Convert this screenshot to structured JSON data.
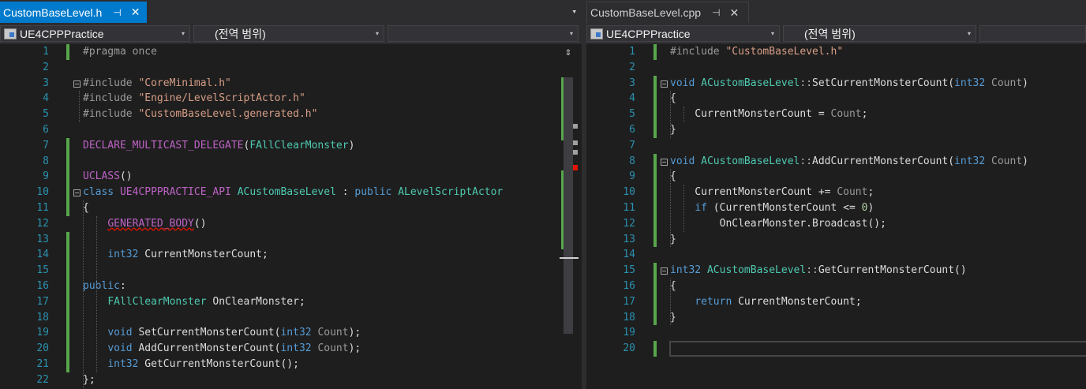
{
  "left_pane": {
    "tab": {
      "title": "CustomBaseLevel.h",
      "pin": "⊣",
      "close": "✕"
    },
    "nav": {
      "project": "UE4CPPPractice",
      "scope": "(전역 범위)",
      "member": ""
    }
  },
  "right_pane": {
    "tab": {
      "title": "CustomBaseLevel.cpp",
      "pin": "⊣",
      "close": "✕"
    },
    "nav": {
      "project": "UE4CPPPractice",
      "scope": "(전역 범위)",
      "member": ""
    }
  },
  "icons": {
    "dropdown": "▾",
    "split": "⇕"
  },
  "colors": {
    "accent": "#007acc",
    "background": "#1e1e1e",
    "line_numbers": "#2b91af",
    "change_bar": "#57a64a",
    "error_mark": "#e51400"
  },
  "header_code": [
    "1",
    "2",
    "3",
    "4",
    "5",
    "6",
    "7",
    "8",
    "9",
    "10",
    "11",
    "12",
    "13",
    "14",
    "15",
    "16",
    "17",
    "18",
    "19",
    "20",
    "21",
    "22"
  ],
  "cpp_code": [
    "1",
    "2",
    "3",
    "4",
    "5",
    "6",
    "7",
    "8",
    "9",
    "10",
    "11",
    "12",
    "13",
    "14",
    "15",
    "16",
    "17",
    "18",
    "19",
    "20"
  ],
  "header_lines": [
    [
      [
        "pp",
        "#pragma once"
      ]
    ],
    [],
    [
      [
        "pp",
        "#include "
      ],
      [
        "str",
        "\"CoreMinimal.h\""
      ]
    ],
    [
      [
        "pp",
        "#include "
      ],
      [
        "str",
        "\"Engine/LevelScriptActor.h\""
      ]
    ],
    [
      [
        "pp",
        "#include "
      ],
      [
        "str",
        "\"CustomBaseLevel.generated.h\""
      ]
    ],
    [],
    [
      [
        "mac",
        "DECLARE_MULTICAST_DELEGATE"
      ],
      [
        "txt",
        "("
      ],
      [
        "typ",
        "FAllClearMonster"
      ],
      [
        "txt",
        ")"
      ]
    ],
    [],
    [
      [
        "mac",
        "UCLASS"
      ],
      [
        "txt",
        "()"
      ]
    ],
    [
      [
        "kw",
        "class "
      ],
      [
        "mac",
        "UE4CPPPRACTICE_API"
      ],
      [
        "txt",
        " "
      ],
      [
        "typ",
        "ACustomBaseLevel"
      ],
      [
        "txt",
        " : "
      ],
      [
        "kw",
        "public "
      ],
      [
        "typ",
        "ALevelScriptActor"
      ]
    ],
    [
      [
        "txt",
        "{"
      ]
    ],
    [
      [
        "txt",
        "    "
      ],
      [
        "mac squig",
        "GENERATED_BODY"
      ],
      [
        "txt",
        "()"
      ]
    ],
    [],
    [
      [
        "txt",
        "    "
      ],
      [
        "kw",
        "int32"
      ],
      [
        "txt",
        " CurrentMonsterCount;"
      ]
    ],
    [],
    [
      [
        "kw",
        "public"
      ],
      [
        "txt",
        ":"
      ]
    ],
    [
      [
        "txt",
        "    "
      ],
      [
        "typ",
        "FAllClearMonster"
      ],
      [
        "txt",
        " OnClearMonster;"
      ]
    ],
    [],
    [
      [
        "txt",
        "    "
      ],
      [
        "kw",
        "void"
      ],
      [
        "txt",
        " SetCurrentMonsterCount("
      ],
      [
        "kw",
        "int32"
      ],
      [
        "txt",
        " "
      ],
      [
        "param",
        "Count"
      ],
      [
        "txt",
        ");"
      ]
    ],
    [
      [
        "txt",
        "    "
      ],
      [
        "kw",
        "void"
      ],
      [
        "txt",
        " AddCurrentMonsterCount("
      ],
      [
        "kw",
        "int32"
      ],
      [
        "txt",
        " "
      ],
      [
        "param",
        "Count"
      ],
      [
        "txt",
        ");"
      ]
    ],
    [
      [
        "txt",
        "    "
      ],
      [
        "kw",
        "int32"
      ],
      [
        "txt",
        " GetCurrentMonsterCount();"
      ]
    ],
    [
      [
        "txt",
        "};"
      ]
    ]
  ],
  "cpp_lines": [
    [
      [
        "pp",
        "#include "
      ],
      [
        "str",
        "\"CustomBaseLevel.h\""
      ]
    ],
    [],
    [
      [
        "kw",
        "void "
      ],
      [
        "typ",
        "ACustomBaseLevel"
      ],
      [
        "op",
        "::"
      ],
      [
        "txt",
        "SetCurrentMonsterCount("
      ],
      [
        "kw",
        "int32"
      ],
      [
        "txt",
        " "
      ],
      [
        "param",
        "Count"
      ],
      [
        "txt",
        ")"
      ]
    ],
    [
      [
        "txt",
        "{"
      ]
    ],
    [
      [
        "txt",
        "    CurrentMonsterCount = "
      ],
      [
        "param",
        "Count"
      ],
      [
        "txt",
        ";"
      ]
    ],
    [
      [
        "txt",
        "}"
      ]
    ],
    [],
    [
      [
        "kw",
        "void "
      ],
      [
        "typ",
        "ACustomBaseLevel"
      ],
      [
        "op",
        "::"
      ],
      [
        "txt",
        "AddCurrentMonsterCount("
      ],
      [
        "kw",
        "int32"
      ],
      [
        "txt",
        " "
      ],
      [
        "param",
        "Count"
      ],
      [
        "txt",
        ")"
      ]
    ],
    [
      [
        "txt",
        "{"
      ]
    ],
    [
      [
        "txt",
        "    CurrentMonsterCount += "
      ],
      [
        "param",
        "Count"
      ],
      [
        "txt",
        ";"
      ]
    ],
    [
      [
        "txt",
        "    "
      ],
      [
        "kw",
        "if"
      ],
      [
        "txt",
        " (CurrentMonsterCount <= "
      ],
      [
        "num",
        "0"
      ],
      [
        "txt",
        ")"
      ]
    ],
    [
      [
        "txt",
        "        OnClearMonster.Broadcast();"
      ]
    ],
    [
      [
        "txt",
        "}"
      ]
    ],
    [],
    [
      [
        "kw",
        "int32 "
      ],
      [
        "typ",
        "ACustomBaseLevel"
      ],
      [
        "op",
        "::"
      ],
      [
        "txt",
        "GetCurrentMonsterCount()"
      ]
    ],
    [
      [
        "txt",
        "{"
      ]
    ],
    [
      [
        "txt",
        "    "
      ],
      [
        "kw",
        "return"
      ],
      [
        "txt",
        " CurrentMonsterCount;"
      ]
    ],
    [
      [
        "txt",
        "}"
      ]
    ],
    [],
    []
  ]
}
